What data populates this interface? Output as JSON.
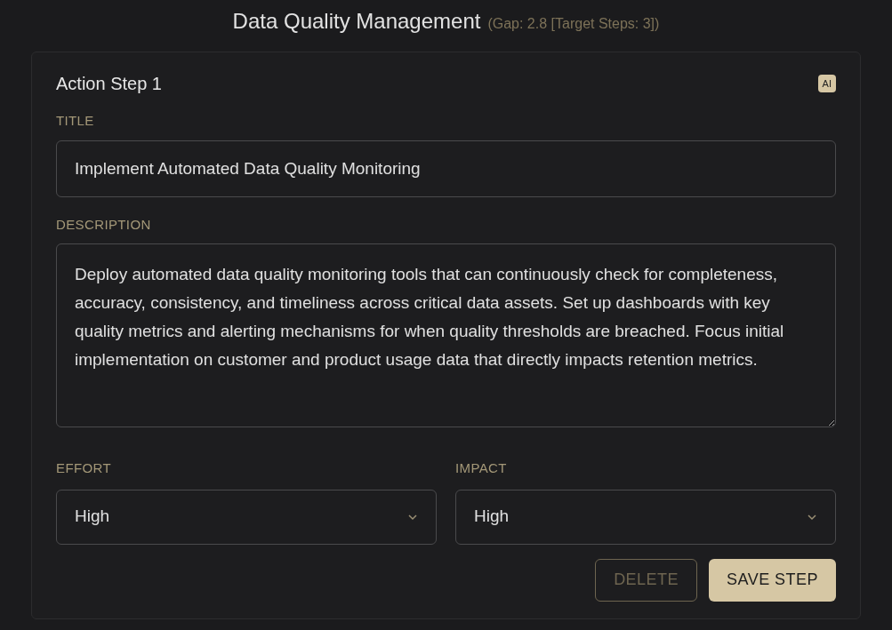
{
  "header": {
    "title": "Data Quality Management",
    "subtitle": "(Gap: 2.8 [Target Steps: 3])"
  },
  "step": {
    "heading": "Action Step 1",
    "badge": "AI",
    "title_field": {
      "label": "TITLE",
      "value": "Implement Automated Data Quality Monitoring"
    },
    "description_field": {
      "label": "DESCRIPTION",
      "value": "Deploy automated data quality monitoring tools that can continuously check for completeness, accuracy, consistency, and timeliness across critical data assets. Set up dashboards with key quality metrics and alerting mechanisms for when quality thresholds are breached. Focus initial implementation on customer and product usage data that directly impacts retention metrics."
    },
    "selects": [
      {
        "label": "EFFORT",
        "value": "High"
      },
      {
        "label": "IMPACT",
        "value": "High"
      }
    ],
    "buttons": [
      {
        "label": "DELETE",
        "kind": "outline"
      },
      {
        "label": "SAVE STEP",
        "kind": "primary"
      }
    ]
  }
}
